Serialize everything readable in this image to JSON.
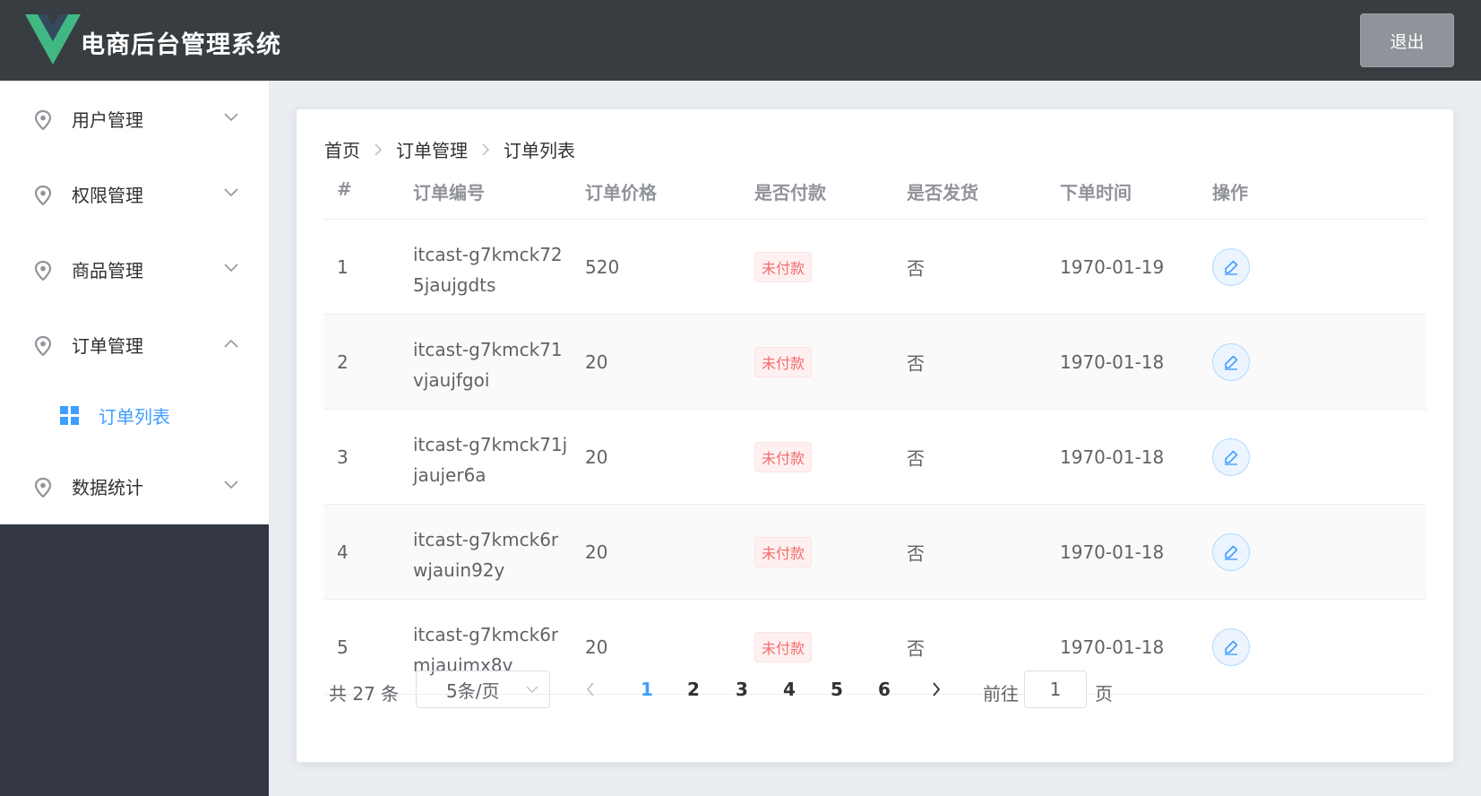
{
  "header": {
    "title": "电商后台管理系统",
    "logout_label": "退出",
    "logo_icon": "vue-logo-icon"
  },
  "sidebar": {
    "items": [
      {
        "label": "用户管理",
        "icon": "location-pin-icon",
        "expanded": false
      },
      {
        "label": "权限管理",
        "icon": "location-pin-icon",
        "expanded": false
      },
      {
        "label": "商品管理",
        "icon": "location-pin-icon",
        "expanded": false
      },
      {
        "label": "订单管理",
        "icon": "location-pin-icon",
        "expanded": true
      },
      {
        "label": "数据统计",
        "icon": "location-pin-icon",
        "expanded": false
      }
    ],
    "active_sub_item": {
      "label": "订单列表",
      "icon": "grid-icon"
    }
  },
  "breadcrumb": [
    "首页",
    "订单管理",
    "订单列表"
  ],
  "table": {
    "headers": [
      "#",
      "订单编号",
      "订单价格",
      "是否付款",
      "是否发货",
      "下单时间",
      "操作"
    ],
    "rows": [
      {
        "index": "1",
        "order_number": "itcast-g7kmck725jaujgdts",
        "price": "520",
        "paid": "未付款",
        "shipped": "否",
        "time": "1970-01-19"
      },
      {
        "index": "2",
        "order_number": "itcast-g7kmck71vjaujfgoi",
        "price": "20",
        "paid": "未付款",
        "shipped": "否",
        "time": "1970-01-18"
      },
      {
        "index": "3",
        "order_number": "itcast-g7kmck71jjaujer6a",
        "price": "20",
        "paid": "未付款",
        "shipped": "否",
        "time": "1970-01-18"
      },
      {
        "index": "4",
        "order_number": "itcast-g7kmck6rwjauin92y",
        "price": "20",
        "paid": "未付款",
        "shipped": "否",
        "time": "1970-01-18"
      },
      {
        "index": "5",
        "order_number": "itcast-g7kmck6rmjauimx8v",
        "price": "20",
        "paid": "未付款",
        "shipped": "否",
        "time": "1970-01-18"
      }
    ]
  },
  "pagination": {
    "total_label": "共 27 条",
    "page_size": "5条/页",
    "pages": [
      "1",
      "2",
      "3",
      "4",
      "5",
      "6"
    ],
    "current_page": "1",
    "goto_label": "前往",
    "goto_value": "1",
    "page_unit": "页"
  },
  "colors": {
    "header_bg": "#373d41",
    "sidebar_bg": "#333744",
    "accent": "#409eff",
    "danger": "#f56c6c"
  }
}
